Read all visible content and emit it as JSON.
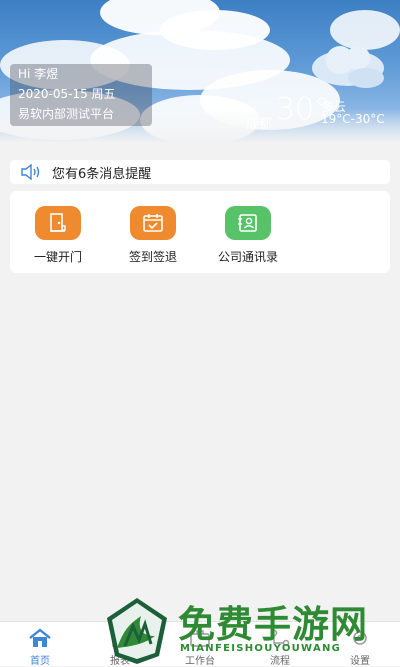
{
  "header": {
    "greeting": "Hi 李煜",
    "date_line": "2020-05-15 周五",
    "platform": "易软内部测试平台"
  },
  "weather": {
    "city": "成都",
    "temperature": "30°",
    "condition": "多云",
    "range": "19°C-30°C"
  },
  "notice": {
    "text": "您有6条消息提醒"
  },
  "functions": [
    {
      "label": "一键开门",
      "color": "#f08a2e",
      "icon": "door-icon"
    },
    {
      "label": "签到签退",
      "color": "#f08a2e",
      "icon": "calendar-icon"
    },
    {
      "label": "公司通讯录",
      "color": "#58c268",
      "icon": "contacts-icon"
    }
  ],
  "tabbar": {
    "items": [
      {
        "label": "首页",
        "icon": "home-icon",
        "active": true
      },
      {
        "label": "报表",
        "icon": "report-icon",
        "active": false
      },
      {
        "label": "工作台",
        "icon": "workbench-icon",
        "active": false
      },
      {
        "label": "流程",
        "icon": "flow-icon",
        "active": false
      },
      {
        "label": "设置",
        "icon": "settings-icon",
        "active": false
      }
    ]
  },
  "watermark": {
    "title": "免费手游网",
    "subtitle": "MIANFEISHOUYOUWANG"
  },
  "colors": {
    "accent": "#3d86d8",
    "orange": "#f08a2e",
    "green": "#58c268"
  }
}
